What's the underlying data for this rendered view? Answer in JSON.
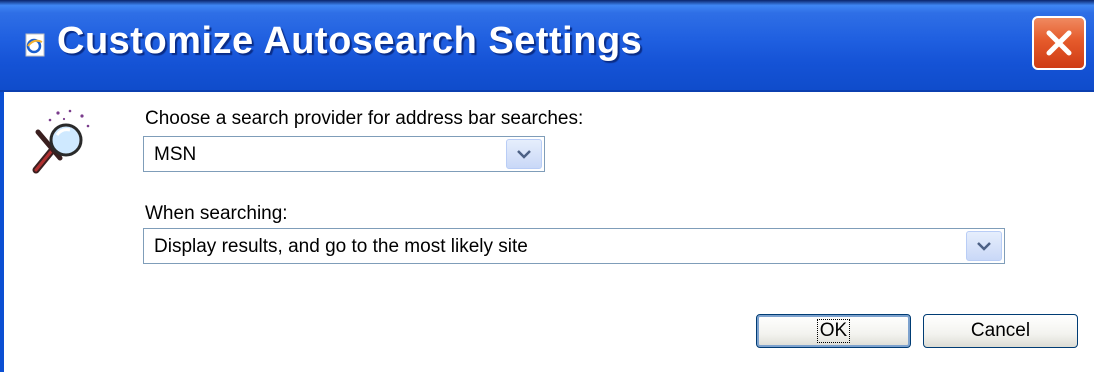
{
  "window": {
    "title": "Customize Autosearch Settings"
  },
  "provider": {
    "label": "Choose a search provider for address bar searches:",
    "selected": "MSN"
  },
  "when_searching": {
    "label": "When searching:",
    "selected": "Display results, and go to the most likely site"
  },
  "buttons": {
    "ok": "OK",
    "cancel": "Cancel"
  },
  "icons": {
    "title": "ie-page-icon",
    "close": "close-icon",
    "search": "magnifier-icon",
    "dropdown": "chevron-down-icon"
  },
  "colors": {
    "titlebar": "#1f5fe0",
    "close_button": "#e55a2b",
    "combo_border": "#7f9db9"
  }
}
